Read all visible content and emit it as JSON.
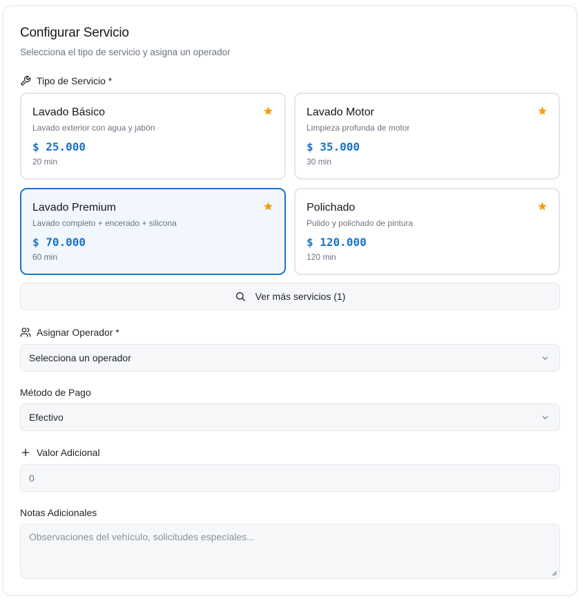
{
  "header": {
    "title": "Configurar Servicio",
    "subtitle": "Selecciona el tipo de servicio y asigna un operador"
  },
  "service_type": {
    "label": "Tipo de Servicio *",
    "icon": "wrench-icon",
    "options": [
      {
        "name": "Lavado Básico",
        "description": "Lavado exterior con agua y jabón",
        "price": "$ 25.000",
        "duration": "20 min",
        "selected": false
      },
      {
        "name": "Lavado Motor",
        "description": "Limpieza profunda de motor",
        "price": "$ 35.000",
        "duration": "30 min",
        "selected": false
      },
      {
        "name": "Lavado Premium",
        "description": "Lavado completo + encerado + silicona",
        "price": "$ 70.000",
        "duration": "60 min",
        "selected": true
      },
      {
        "name": "Polichado",
        "description": "Pulido y polichado de pintura",
        "price": "$ 120.000",
        "duration": "120 min",
        "selected": false
      }
    ],
    "more_button": "Ver más servicios (1)"
  },
  "operator": {
    "label": "Asignar Operador *",
    "icon": "users-icon",
    "value": "Selecciona un operador"
  },
  "payment": {
    "label": "Método de Pago",
    "value": "Efectivo"
  },
  "extra_value": {
    "label": "Valor Adicional",
    "icon": "plus-icon",
    "value": "0"
  },
  "notes": {
    "label": "Notas Adicionales",
    "placeholder": "Observaciones del vehículo, solicitudes especiales..."
  },
  "colors": {
    "accent": "#1a73c8",
    "star": "#f59e0b",
    "selected_bg": "#f1f7fd",
    "border": "#e3e6ea"
  }
}
